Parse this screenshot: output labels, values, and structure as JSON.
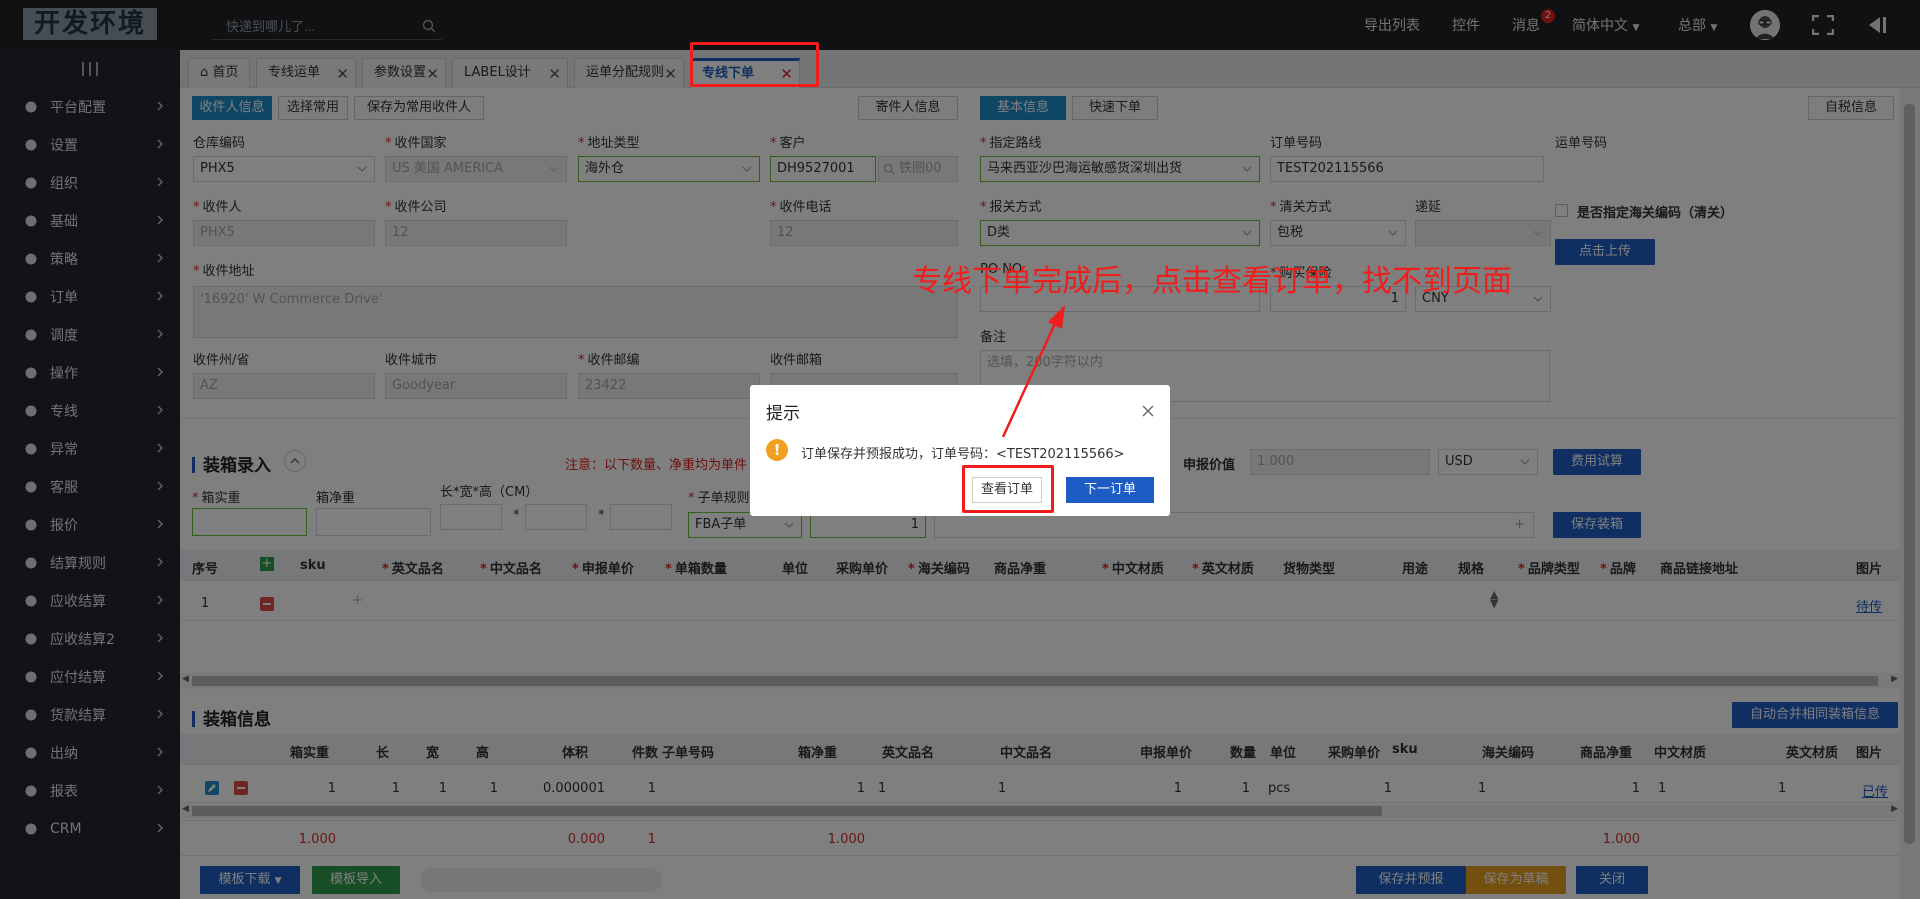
{
  "app": {
    "logo": "开发环境",
    "search_placeholder": "快递到哪儿了..."
  },
  "topnav": {
    "export": "导出列表",
    "controls": "控件",
    "messages": "消息",
    "messages_count": "2",
    "language": "简体中文",
    "hq": "总部"
  },
  "sidebar": {
    "items": [
      "平台配置",
      "设置",
      "组织",
      "基础",
      "策略",
      "订单",
      "调度",
      "操作",
      "专线",
      "异常",
      "客服",
      "报价",
      "结算规则",
      "应收结算",
      "应收结算2",
      "应付结算",
      "货款结算",
      "出纳",
      "报表",
      "CRM"
    ]
  },
  "tabs": [
    {
      "label": "首页",
      "closable": false
    },
    {
      "label": "专线运单",
      "closable": true
    },
    {
      "label": "参数设置",
      "closable": true
    },
    {
      "label": "LABEL设计",
      "closable": true
    },
    {
      "label": "运单分配规则",
      "closable": true
    },
    {
      "label": "专线下单",
      "closable": true,
      "active": true
    }
  ],
  "left": {
    "buttons": {
      "receiver_info": "收件人信息",
      "choose_common": "选择常用",
      "save_common": "保存为常用收件人",
      "sender_info": "寄件人信息"
    },
    "labels": {
      "warehouse": "仓库编码",
      "country": "收件国家",
      "addr_type": "地址类型",
      "customer": "客户",
      "receiver": "收件人",
      "company": "收件公司",
      "phone": "收件电话",
      "address": "收件地址",
      "state": "收件州/省",
      "city": "收件城市",
      "zip": "收件邮编",
      "email": "收件邮箱"
    },
    "values": {
      "warehouse": "PHX5",
      "country": "US 美国 AMERICA",
      "addr_type": "海外仓",
      "customer": "DH9527001",
      "customer_search": "铁圈00",
      "receiver": "PHX5",
      "company": "12",
      "phone": "12",
      "address": "'16920' W Commerce Drive'",
      "state": "AZ",
      "city": "Goodyear",
      "zip": "23422"
    }
  },
  "right": {
    "buttons": {
      "basic_info": "基本信息",
      "quick_order": "快速下单",
      "tax_info": "自税信息",
      "upload": "点击上传"
    },
    "labels": {
      "route": "指定路线",
      "order_no": "订单号码",
      "waybill_no": "运单号码",
      "declare": "报关方式",
      "clearance": "清关方式",
      "deliver": "递延",
      "customs_code": "是否指定海关编码（清关）",
      "po": "PO NO",
      "insurance": "购买保险",
      "remark": "备注"
    },
    "values": {
      "route": "马来西亚沙巴海运敏感货深圳出货",
      "order_no": "TEST202115566",
      "declare": "D类",
      "clearance": "包税",
      "insurance_qty": "1",
      "currency": "CNY",
      "remark_placeholder": "选填，200字符以内"
    }
  },
  "packing": {
    "title": "装箱录入",
    "note": "注意：以下数量、净重均为单件",
    "declare_value_label": "申报价值",
    "declare_value": "1.000",
    "currency": "USD",
    "fee_button": "费用试算",
    "save_button": "保存装箱",
    "labels": {
      "box_weight": "箱实重",
      "box_net": "箱净重",
      "dims": "长*宽*高（CM）",
      "sub_rule": "子单规则"
    },
    "sub_rule_value": "FBA子单",
    "sub_qty": "1",
    "columns": [
      "序号",
      "sku",
      "英文品名",
      "中文品名",
      "申报单价",
      "单箱数量",
      "单位",
      "采购单价",
      "海关编码",
      "商品净重",
      "中文材质",
      "英文材质",
      "货物类型",
      "用途",
      "规格",
      "品牌类型",
      "品牌",
      "商品链接地址",
      "图片"
    ],
    "row": {
      "no": "1",
      "image_link": "待传"
    }
  },
  "boxes": {
    "title": "装箱信息",
    "merge_button": "自动合并相同装箱信息",
    "columns": [
      "箱实重",
      "长",
      "宽",
      "高",
      "体积",
      "件数",
      "子单号码",
      "箱净重",
      "英文品名",
      "中文品名",
      "申报单价",
      "数量",
      "单位",
      "采购单价",
      "sku",
      "海关编码",
      "商品净重",
      "中文材质",
      "英文材质",
      "图片"
    ],
    "row": {
      "weight": "1",
      "l": "1",
      "w": "1",
      "h": "1",
      "volume": "0.000001",
      "pieces": "1",
      "net": "1",
      "en": "1",
      "cn": "1",
      "price": "1",
      "qty": "1",
      "unit": "pcs",
      "purchase": "1",
      "hs": "1",
      "goods_net": "1",
      "cn_mat": "1",
      "en_mat": "1",
      "image": "已传"
    },
    "totals": {
      "weight": "1.000",
      "volume": "0.000",
      "pieces": "1",
      "net": "1.000",
      "goods_net": "1.000"
    }
  },
  "bottom": {
    "template_download": "模板下载",
    "template_import": "模板导入",
    "save_forecast": "保存并预报",
    "save_draft": "保存为草稿",
    "close": "关闭"
  },
  "dialog": {
    "title": "提示",
    "message": "订单保存并预报成功，订单号码：<TEST202115566>",
    "view_order": "查看订单",
    "next_order": "下一订单"
  },
  "annotation": "专线下单完成后，点击查看订单，找不到页面",
  "colors": {
    "primary": "#1e5cc5",
    "annotation_red": "#f01d1d",
    "warning": "#f0a020",
    "sidebar": "#23272c"
  }
}
